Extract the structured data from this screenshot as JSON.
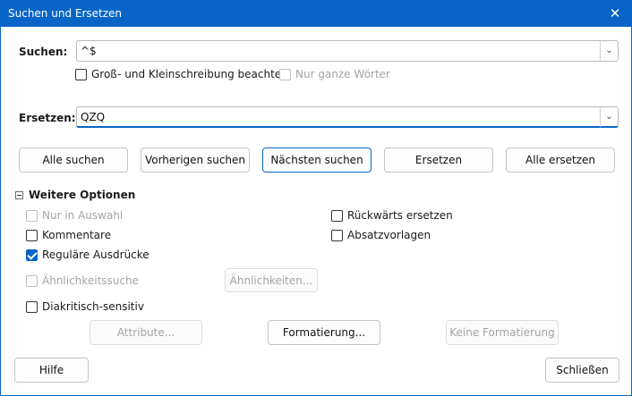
{
  "window": {
    "title": "Suchen und Ersetzen",
    "close_glyph": "✕"
  },
  "search": {
    "label": "Suchen:",
    "value": "^$",
    "match_case_label": "Groß- und Kleinschreibung beachten",
    "match_case_checked": false,
    "whole_words_label": "Nur ganze Wörter",
    "whole_words_checked": false,
    "whole_words_enabled": false
  },
  "replace": {
    "label": "Ersetzen:",
    "value": "QZQ"
  },
  "actions": {
    "find_all": "Alle suchen",
    "find_previous": "Vorherigen suchen",
    "find_next": "Nächsten suchen",
    "replace": "Ersetzen",
    "replace_all": "Alle ersetzen"
  },
  "more_options": {
    "title": "Weitere Optionen",
    "expanded": true,
    "current_selection_only": {
      "label": "Nur in Auswahl",
      "checked": false,
      "enabled": false
    },
    "replace_backwards": {
      "label": "Rückwärts ersetzen",
      "checked": false,
      "enabled": true
    },
    "comments": {
      "label": "Kommentare",
      "checked": false,
      "enabled": true
    },
    "paragraph_styles": {
      "label": "Absatzvorlagen",
      "checked": false,
      "enabled": true
    },
    "regular_expressions": {
      "label": "Reguläre Ausdrücke",
      "checked": true,
      "enabled": true
    },
    "similarity_search": {
      "label": "Ähnlichkeitssuche",
      "checked": false,
      "enabled": false
    },
    "similarities_button": "Ähnlichkeiten...",
    "diacritics_sensitive": {
      "label": "Diakritisch-sensitiv",
      "checked": false,
      "enabled": true
    },
    "attributes_button": "Attribute...",
    "format_button": "Formatierung...",
    "no_format_button": "Keine Formatierung"
  },
  "footer": {
    "help": "Hilfe",
    "close": "Schließen"
  },
  "colors": {
    "accent": "#0865c7"
  }
}
